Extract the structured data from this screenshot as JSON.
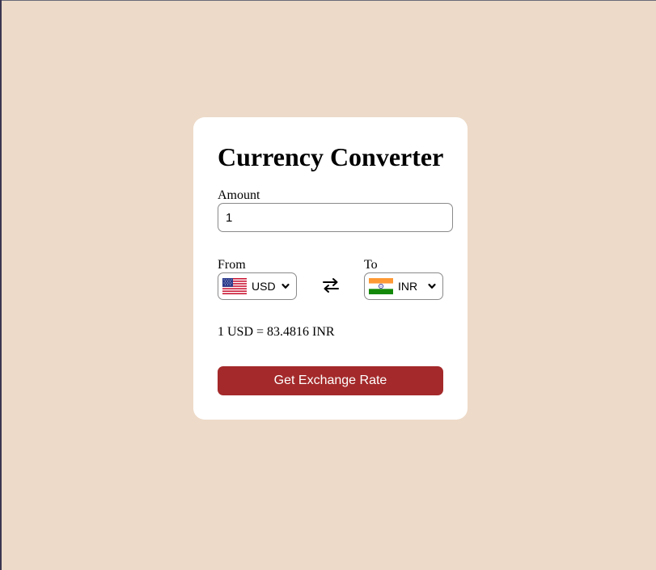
{
  "app": {
    "title": "Currency Converter"
  },
  "form": {
    "amount_label": "Amount",
    "amount_value": "1",
    "from_label": "From",
    "to_label": "To",
    "from_currency": {
      "code": "USD",
      "flag_icon": "us-flag-icon"
    },
    "to_currency": {
      "code": "INR",
      "flag_icon": "india-flag-icon"
    },
    "swap_icon": "swap-arrows-icon",
    "result_text": "1 USD = 83.4816 INR",
    "submit_label": "Get Exchange Rate"
  },
  "colors": {
    "page_background": "#eddac8",
    "card_background": "#ffffff",
    "button_background": "#a4292a",
    "button_text": "#ffffff"
  }
}
